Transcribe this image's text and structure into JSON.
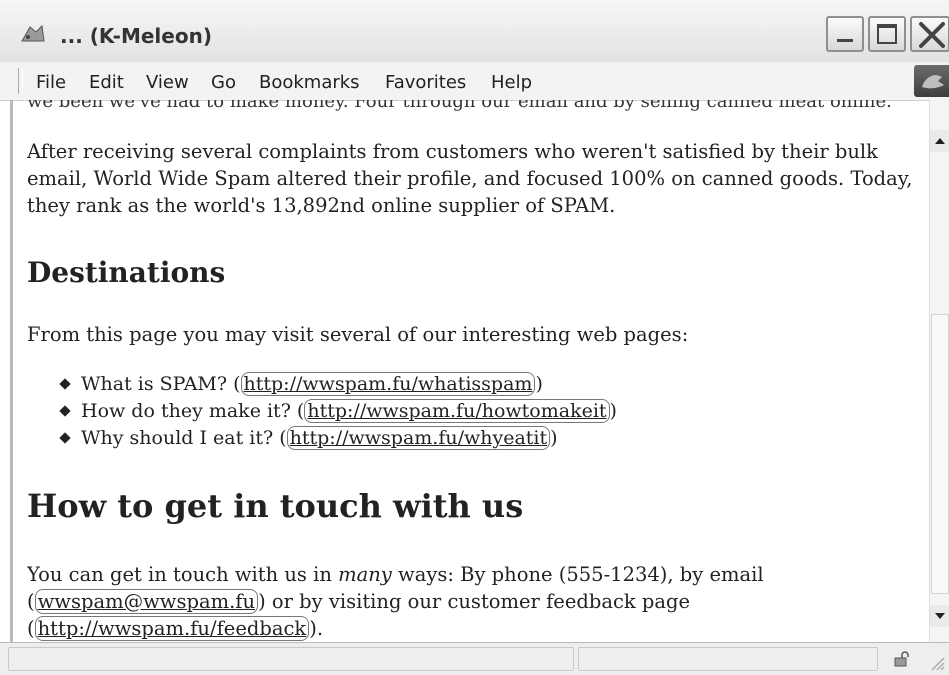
{
  "window": {
    "title": "... (K-Meleon)"
  },
  "menu": {
    "items": [
      "File",
      "Edit",
      "View",
      "Go",
      "Bookmarks",
      "Favorites",
      "Help"
    ]
  },
  "content": {
    "cut_line": "we been we've had to make money. Four through our email and by selling canned meat online.",
    "paragraph1": "After receiving several complaints from customers who weren't satisfied by their bulk email, World Wide Spam altered their profile, and focused 100% on canned goods. Today, they rank as the world's 13,892nd online supplier of SPAM.",
    "heading_destinations": "Destinations",
    "paragraph2": "From this page you may visit several of our interesting web pages:",
    "links": [
      {
        "text": "What is SPAM?",
        "url": "http://wwspam.fu/whatisspam"
      },
      {
        "text": "How do they make it?",
        "url": "http://wwspam.fu/howtomakeit"
      },
      {
        "text": "Why should I eat it?",
        "url": "http://wwspam.fu/whyeatit"
      }
    ],
    "heading_contact": "How to get in touch with us",
    "contact": {
      "t1": "You can get in touch with us in ",
      "t_em": "many",
      "t2": " ways: By phone (555-1234), by email",
      "email": "wwspam@wwspam.fu",
      "t3": " or by visiting our customer feedback page ",
      "feedback_url": "http://wwspam.fu/feedback",
      "t4": "."
    }
  },
  "colors": {
    "text": "#222222",
    "chrome": "#eeeeee",
    "titlebar": "#e2e2e2"
  },
  "icons": [
    "k-meleon-app-icon",
    "minimize-icon",
    "maximize-icon",
    "close-icon",
    "throbber-icon",
    "scroll-up-icon",
    "scroll-down-icon",
    "lock-icon",
    "resize-grip-icon"
  ]
}
